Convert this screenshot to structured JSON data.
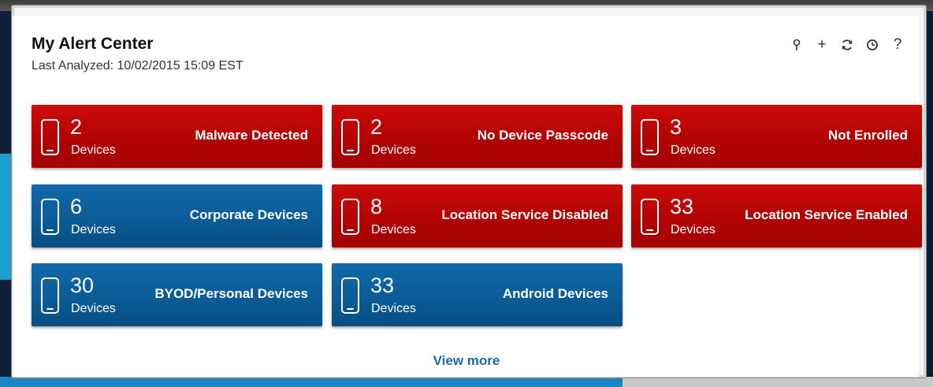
{
  "header": {
    "title": "My Alert Center",
    "last_analyzed_label": "Last Analyzed:",
    "last_analyzed_value": "10/02/2015 15:09 EST"
  },
  "toolbar": {
    "tools": [
      "pin-icon",
      "add-icon",
      "refresh-icon",
      "clock-icon",
      "help-icon"
    ],
    "add_glyph": "+",
    "help_glyph": "?"
  },
  "tiles": [
    {
      "count": "2",
      "unit": "Devices",
      "label": "Malware Detected",
      "color": "red"
    },
    {
      "count": "2",
      "unit": "Devices",
      "label": "No Device Passcode",
      "color": "red"
    },
    {
      "count": "3",
      "unit": "Devices",
      "label": "Not Enrolled",
      "color": "red"
    },
    {
      "count": "6",
      "unit": "Devices",
      "label": "Corporate Devices",
      "color": "blue"
    },
    {
      "count": "8",
      "unit": "Devices",
      "label": "Location Service Disabled",
      "color": "red"
    },
    {
      "count": "33",
      "unit": "Devices",
      "label": "Location Service Enabled",
      "color": "red"
    },
    {
      "count": "30",
      "unit": "Devices",
      "label": "BYOD/Personal Devices",
      "color": "blue"
    },
    {
      "count": "33",
      "unit": "Devices",
      "label": "Android Devices",
      "color": "blue"
    }
  ],
  "footer": {
    "view_more": "View more"
  },
  "colors": {
    "alert_red": "#b00303",
    "info_blue": "#0a5a95",
    "link_blue": "#1a6aa8"
  }
}
